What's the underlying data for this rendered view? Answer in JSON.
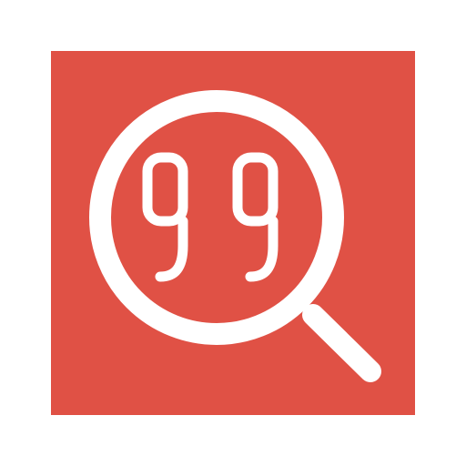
{
  "icon": {
    "name": "quote-search-icon",
    "symbol": "magnifying-glass-with-quotation-marks",
    "colors": {
      "background": "#E05145",
      "foreground": "#FFFFFF",
      "page": "#FFFFFF"
    }
  }
}
